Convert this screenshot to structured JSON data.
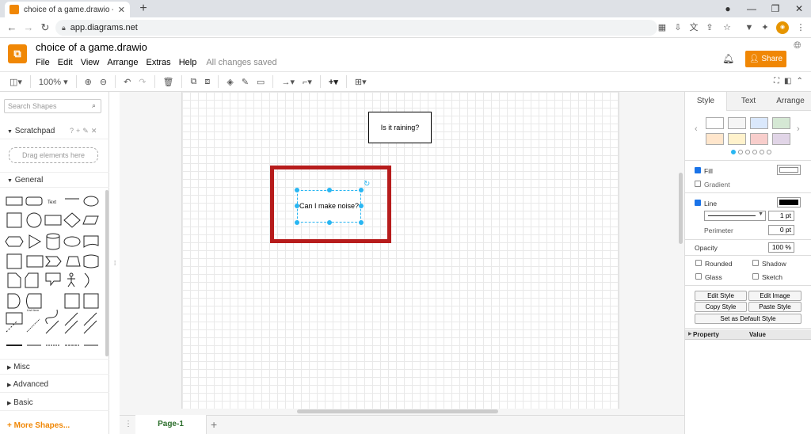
{
  "browser": {
    "tab_title": "choice of a game.drawio - diagrams.net",
    "url": "app.diagrams.net"
  },
  "app": {
    "title": "choice of a game.drawio",
    "menu": [
      "File",
      "Edit",
      "View",
      "Arrange",
      "Extras",
      "Help"
    ],
    "status": "All changes saved",
    "share_label": "Share"
  },
  "toolbar": {
    "zoom": "100%"
  },
  "sidebar": {
    "search_placeholder": "Search Shapes",
    "scratchpad": "Scratchpad",
    "drop_hint": "Drag elements here",
    "general": "General",
    "text_shape": "Text",
    "list_item": "List Item",
    "sections": [
      "Misc",
      "Advanced",
      "Basic"
    ],
    "more_shapes": "+ More Shapes..."
  },
  "diagram": {
    "node1": "Is it raining?",
    "node2": "Can I make noise?"
  },
  "pages": {
    "current": "Page-1"
  },
  "format": {
    "tabs": [
      "Style",
      "Text",
      "Arrange"
    ],
    "swatches": [
      "#ffffff",
      "#f5f5f5",
      "#dae8fc",
      "#d5e8d4",
      "#ffe6cc",
      "#fff2cc",
      "#f8cecc",
      "#e1d5e7"
    ],
    "fill": "Fill",
    "gradient": "Gradient",
    "line": "Line",
    "line_width": "1 pt",
    "perimeter": "Perimeter",
    "perimeter_value": "0 pt",
    "opacity": "Opacity",
    "opacity_value": "100 %",
    "rounded": "Rounded",
    "shadow": "Shadow",
    "glass": "Glass",
    "sketch": "Sketch",
    "buttons": [
      "Edit Style",
      "Edit Image",
      "Copy Style",
      "Paste Style",
      "Set as Default Style"
    ],
    "prop_header": "Property",
    "value_header": "Value"
  },
  "colors": {
    "accent": "#f08705",
    "selection": "#29b6f2",
    "highlight": "#b71c1c"
  }
}
